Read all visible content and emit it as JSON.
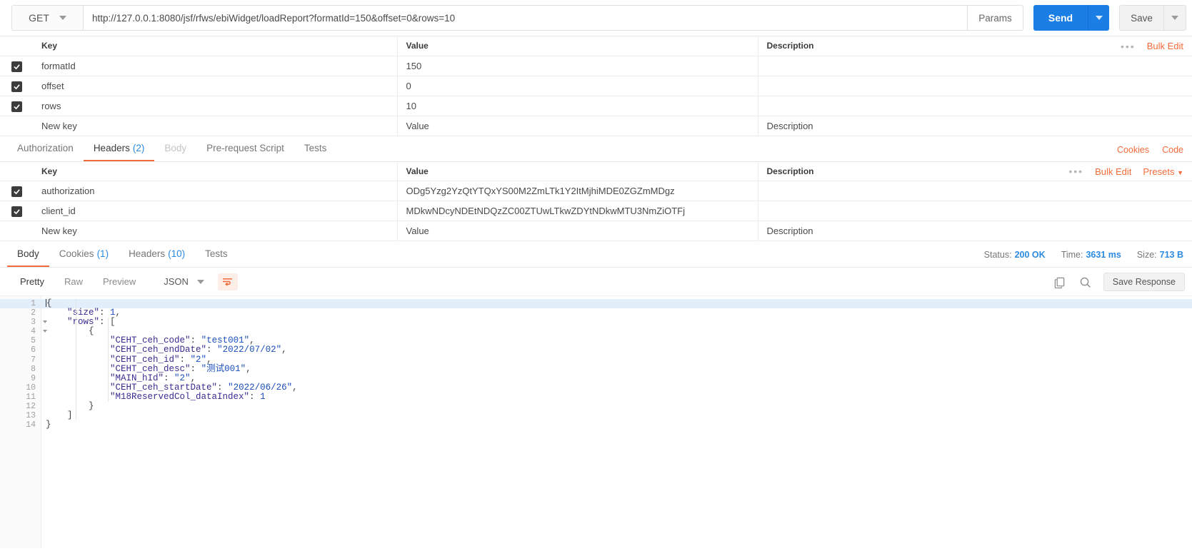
{
  "request": {
    "method": "GET",
    "url": "http://127.0.0.1:8080/jsf/rfws/ebiWidget/loadReport?formatId=150&offset=0&rows=10",
    "params_button": "Params",
    "send_button": "Send",
    "save_button": "Save"
  },
  "params_table": {
    "headers": {
      "key": "Key",
      "value": "Value",
      "description": "Description"
    },
    "bulk_edit": "Bulk Edit",
    "rows": [
      {
        "checked": true,
        "key": "formatId",
        "value": "150",
        "description": ""
      },
      {
        "checked": true,
        "key": "offset",
        "value": "0",
        "description": ""
      },
      {
        "checked": true,
        "key": "rows",
        "value": "10",
        "description": ""
      }
    ],
    "new_row": {
      "key": "New key",
      "value": "Value",
      "description": "Description"
    }
  },
  "request_tabs": {
    "items": [
      {
        "label": "Authorization",
        "count": "",
        "active": false,
        "disabled": false
      },
      {
        "label": "Headers",
        "count": "(2)",
        "active": true,
        "disabled": false
      },
      {
        "label": "Body",
        "count": "",
        "active": false,
        "disabled": true
      },
      {
        "label": "Pre-request Script",
        "count": "",
        "active": false,
        "disabled": false
      },
      {
        "label": "Tests",
        "count": "",
        "active": false,
        "disabled": false
      }
    ],
    "cookies_link": "Cookies",
    "code_link": "Code"
  },
  "headers_table": {
    "headers": {
      "key": "Key",
      "value": "Value",
      "description": "Description"
    },
    "bulk_edit": "Bulk Edit",
    "presets": "Presets",
    "rows": [
      {
        "checked": true,
        "key": "authorization",
        "value": "ODg5Yzg2YzQtYTQxYS00M2ZmLTk1Y2ItMjhiMDE0ZGZmMDgz",
        "description": ""
      },
      {
        "checked": true,
        "key": "client_id",
        "value": "MDkwNDcyNDEtNDQzZC00ZTUwLTkwZDYtNDkwMTU3NmZiOTFj",
        "description": ""
      }
    ],
    "new_row": {
      "key": "New key",
      "value": "Value",
      "description": "Description"
    }
  },
  "response_tabs": {
    "items": [
      {
        "label": "Body",
        "count": "",
        "active": true
      },
      {
        "label": "Cookies",
        "count": "(1)",
        "active": false
      },
      {
        "label": "Headers",
        "count": "(10)",
        "active": false
      },
      {
        "label": "Tests",
        "count": "",
        "active": false
      }
    ],
    "status_label": "Status:",
    "status_value": "200 OK",
    "time_label": "Time:",
    "time_value": "3631 ms",
    "size_label": "Size:",
    "size_value": "713 B"
  },
  "response_toolbar": {
    "views": [
      {
        "label": "Pretty",
        "active": true
      },
      {
        "label": "Raw",
        "active": false
      },
      {
        "label": "Preview",
        "active": false
      }
    ],
    "format": "JSON",
    "save_response": "Save Response"
  },
  "response_body": {
    "lines": [
      {
        "n": "1",
        "fold": true,
        "tokens": [
          {
            "t": "{",
            "c": "p"
          }
        ]
      },
      {
        "n": "2",
        "fold": false,
        "tokens": [
          {
            "t": "    \"size\"",
            "c": "k"
          },
          {
            "t": ": ",
            "c": "p"
          },
          {
            "t": "1",
            "c": "n"
          },
          {
            "t": ",",
            "c": "p"
          }
        ]
      },
      {
        "n": "3",
        "fold": true,
        "tokens": [
          {
            "t": "    \"rows\"",
            "c": "k"
          },
          {
            "t": ": [",
            "c": "p"
          }
        ]
      },
      {
        "n": "4",
        "fold": true,
        "tokens": [
          {
            "t": "        {",
            "c": "p"
          }
        ]
      },
      {
        "n": "5",
        "fold": false,
        "tokens": [
          {
            "t": "            \"CEHT_ceh_code\"",
            "c": "k"
          },
          {
            "t": ": ",
            "c": "p"
          },
          {
            "t": "\"test001\"",
            "c": "s"
          },
          {
            "t": ",",
            "c": "p"
          }
        ]
      },
      {
        "n": "6",
        "fold": false,
        "tokens": [
          {
            "t": "            \"CEHT_ceh_endDate\"",
            "c": "k"
          },
          {
            "t": ": ",
            "c": "p"
          },
          {
            "t": "\"2022/07/02\"",
            "c": "s"
          },
          {
            "t": ",",
            "c": "p"
          }
        ]
      },
      {
        "n": "7",
        "fold": false,
        "tokens": [
          {
            "t": "            \"CEHT_ceh_id\"",
            "c": "k"
          },
          {
            "t": ": ",
            "c": "p"
          },
          {
            "t": "\"2\"",
            "c": "s"
          },
          {
            "t": ",",
            "c": "p"
          }
        ]
      },
      {
        "n": "8",
        "fold": false,
        "tokens": [
          {
            "t": "            \"CEHT_ceh_desc\"",
            "c": "k"
          },
          {
            "t": ": ",
            "c": "p"
          },
          {
            "t": "\"测试001\"",
            "c": "s"
          },
          {
            "t": ",",
            "c": "p"
          }
        ]
      },
      {
        "n": "9",
        "fold": false,
        "tokens": [
          {
            "t": "            \"MAIN_hId\"",
            "c": "k"
          },
          {
            "t": ": ",
            "c": "p"
          },
          {
            "t": "\"2\"",
            "c": "s"
          },
          {
            "t": ",",
            "c": "p"
          }
        ]
      },
      {
        "n": "10",
        "fold": false,
        "tokens": [
          {
            "t": "            \"CEHT_ceh_startDate\"",
            "c": "k"
          },
          {
            "t": ": ",
            "c": "p"
          },
          {
            "t": "\"2022/06/26\"",
            "c": "s"
          },
          {
            "t": ",",
            "c": "p"
          }
        ]
      },
      {
        "n": "11",
        "fold": false,
        "tokens": [
          {
            "t": "            \"M18ReservedCol_dataIndex\"",
            "c": "k"
          },
          {
            "t": ": ",
            "c": "p"
          },
          {
            "t": "1",
            "c": "n"
          }
        ]
      },
      {
        "n": "12",
        "fold": false,
        "tokens": [
          {
            "t": "        }",
            "c": "p"
          }
        ]
      },
      {
        "n": "13",
        "fold": false,
        "tokens": [
          {
            "t": "    ]",
            "c": "p"
          }
        ]
      },
      {
        "n": "14",
        "fold": false,
        "tokens": [
          {
            "t": "}",
            "c": "p"
          }
        ]
      }
    ]
  }
}
